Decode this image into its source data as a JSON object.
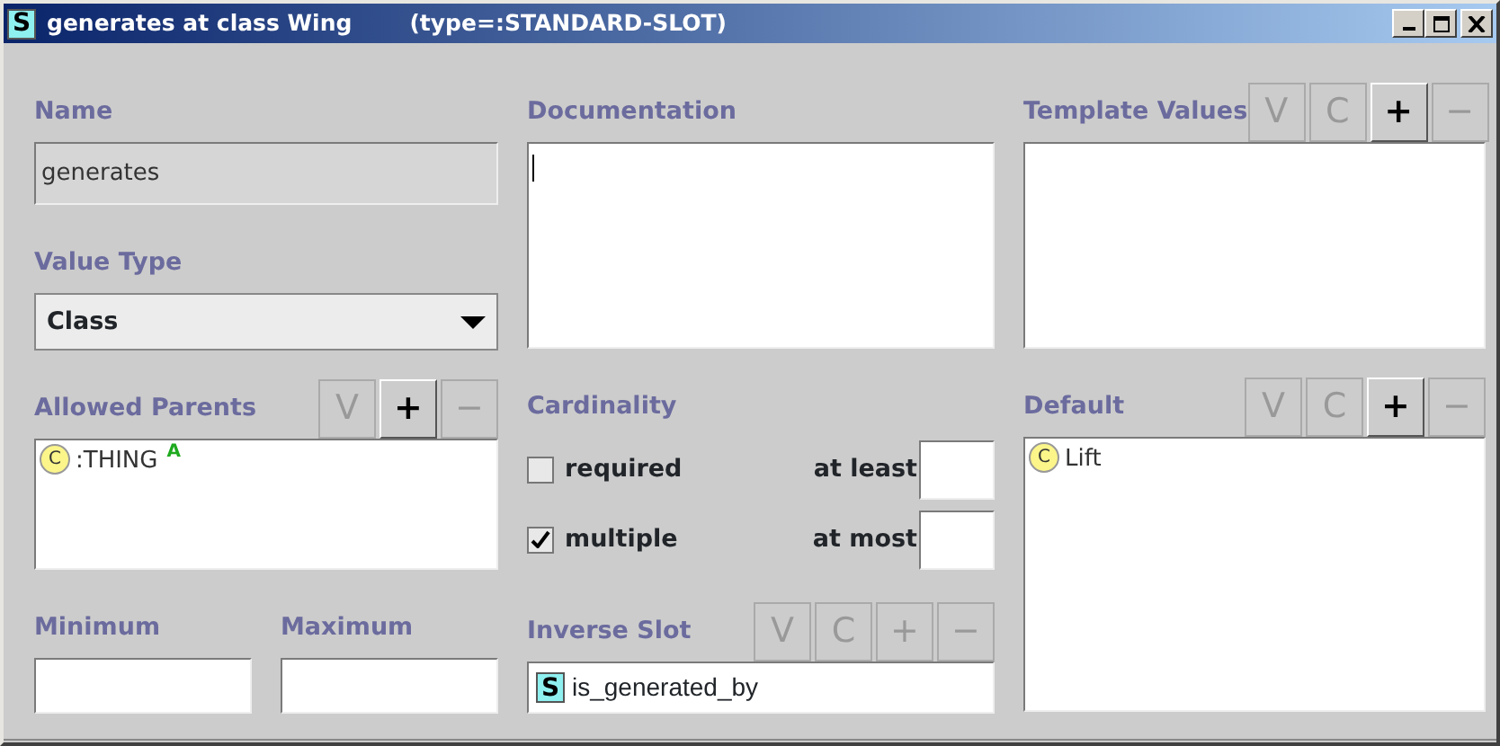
{
  "window": {
    "type_letter": "S",
    "title": "generates at class Wing",
    "subtitle": "(type=:STANDARD-SLOT)"
  },
  "name": {
    "label": "Name",
    "value": "generates",
    "disabled": true
  },
  "value_type": {
    "label": "Value Type",
    "value": "Class"
  },
  "allowed_parents": {
    "label": "Allowed Parents",
    "buttons": [
      {
        "label": "V",
        "disabled": true
      },
      {
        "label": "+",
        "disabled": false
      },
      {
        "label": "−",
        "disabled": true
      }
    ],
    "items": [
      {
        "type_letter": "C",
        "text": ":THING",
        "badge": "A"
      }
    ]
  },
  "minimum": {
    "label": "Minimum"
  },
  "maximum": {
    "label": "Maximum"
  },
  "documentation": {
    "label": "Documentation",
    "focused": true
  },
  "cardinality": {
    "label": "Cardinality",
    "options": [
      {
        "label": "required",
        "checked": false,
        "bound_label": "at least"
      },
      {
        "label": "multiple",
        "checked": true,
        "bound_label": "at most"
      }
    ]
  },
  "inverse_slot": {
    "label": "Inverse Slot",
    "buttons": [
      {
        "label": "V",
        "disabled": true
      },
      {
        "label": "C",
        "disabled": true
      },
      {
        "label": "+",
        "disabled": true
      },
      {
        "label": "−",
        "disabled": true
      }
    ],
    "type_letter": "S",
    "value": "is_generated_by"
  },
  "template_values": {
    "label": "Template Values",
    "buttons": [
      {
        "label": "V",
        "disabled": true
      },
      {
        "label": "C",
        "disabled": true
      },
      {
        "label": "+",
        "disabled": false
      },
      {
        "label": "−",
        "disabled": true
      }
    ]
  },
  "default": {
    "label": "Default",
    "buttons": [
      {
        "label": "V",
        "disabled": true
      },
      {
        "label": "C",
        "disabled": true
      },
      {
        "label": "+",
        "disabled": false
      },
      {
        "label": "−",
        "disabled": true
      }
    ],
    "items": [
      {
        "type_letter": "C",
        "text": "Lift"
      }
    ]
  }
}
